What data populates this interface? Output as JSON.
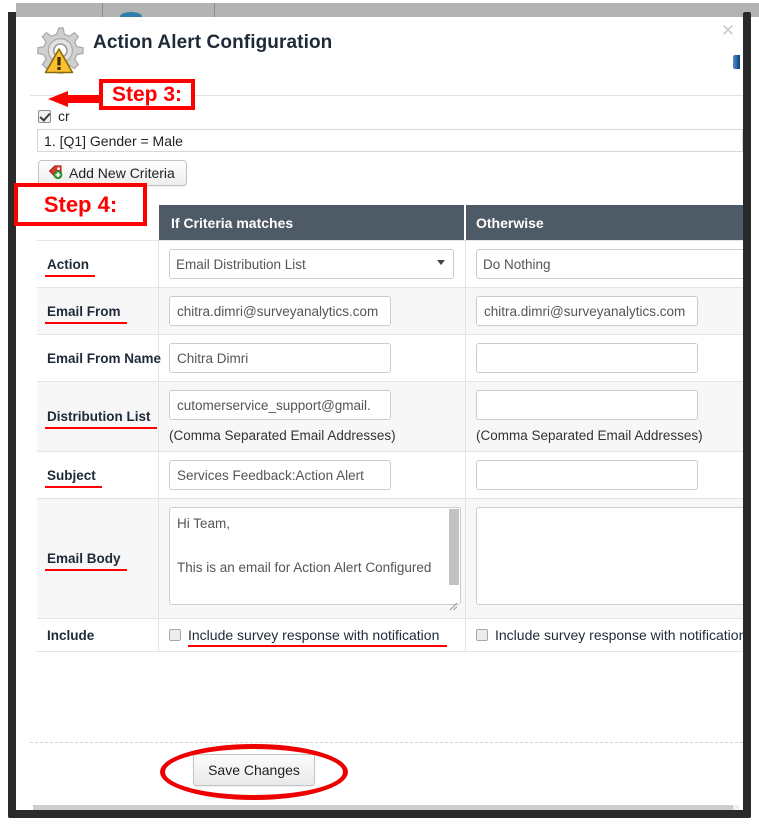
{
  "window": {
    "close_icon": "close-icon",
    "scroll_indicator": "scroll-thumb"
  },
  "dialog": {
    "title": "Action Alert Configuration",
    "icons": {
      "gear": "gear-icon",
      "warning": "warning-triangle-icon"
    }
  },
  "criteria": {
    "checkbox_checked": true,
    "checkbox_label": "cr",
    "list_item": "1. [Q1] Gender =  Male",
    "add_button_label": "Add New Criteria",
    "add_button_icon": "add-tag-icon"
  },
  "table": {
    "headers": {
      "label_col": "",
      "if_match": "If Criteria matches",
      "otherwise": "Otherwise"
    },
    "rows": [
      {
        "label": "Action",
        "underlined": true,
        "type": "select",
        "if_value": "Email Distribution List",
        "otherwise_value": "Do Nothing"
      },
      {
        "label": "Email From",
        "underlined": true,
        "type": "text",
        "if_value": "chitra.dimri@surveyanalytics.com",
        "otherwise_value": "chitra.dimri@surveyanalytics.com"
      },
      {
        "label": "Email From Name",
        "underlined": false,
        "type": "text",
        "if_value": "Chitra Dimri",
        "otherwise_value": ""
      },
      {
        "label": "Distribution List",
        "underlined": true,
        "type": "text",
        "if_value": "cutomerservice_support@gmail.",
        "otherwise_value": "",
        "if_hint": "(Comma Separated Email Addresses)",
        "otherwise_hint": "(Comma Separated Email Addresses)"
      },
      {
        "label": "Subject ",
        "underlined": true,
        "type": "text",
        "if_value": "Services Feedback:Action Alert",
        "otherwise_value": ""
      },
      {
        "label": "Email Body",
        "underlined": true,
        "type": "textarea",
        "if_value": "Hi Team,\n\nThis is an email for Action Alert Configured\n\nThank's",
        "otherwise_value": ""
      },
      {
        "label": "Include",
        "underlined": false,
        "type": "checkbox",
        "if_value": "Include survey response with notification",
        "otherwise_value": "Include survey response with notification"
      }
    ]
  },
  "footer": {
    "save_label": "Save Changes"
  },
  "annotations": {
    "step3": "Step 3:",
    "step4": "Step 4:",
    "color": "#ff0000"
  }
}
